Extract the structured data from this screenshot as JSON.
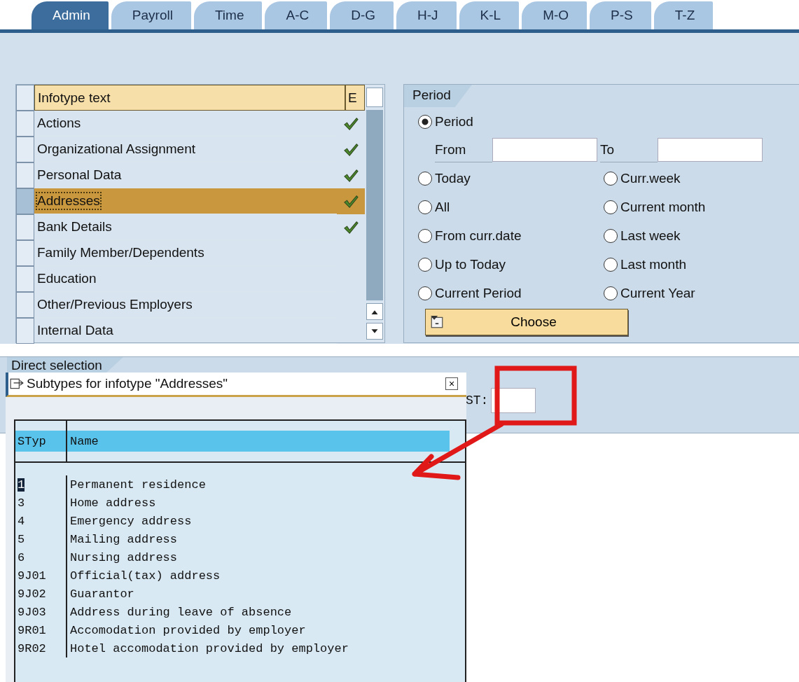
{
  "tabs": [
    {
      "label": "Admin",
      "selected": true
    },
    {
      "label": "Payroll",
      "selected": false
    },
    {
      "label": "Time",
      "selected": false
    },
    {
      "label": "A-C",
      "selected": false
    },
    {
      "label": "D-G",
      "selected": false
    },
    {
      "label": "H-J",
      "selected": false
    },
    {
      "label": "K-L",
      "selected": false
    },
    {
      "label": "M-O",
      "selected": false
    },
    {
      "label": "P-S",
      "selected": false
    },
    {
      "label": "T-Z",
      "selected": false
    }
  ],
  "infotypes": {
    "columns": [
      "Infotype text",
      "E"
    ],
    "rows": [
      {
        "name": "Actions",
        "checked": true,
        "selected": false
      },
      {
        "name": "Organizational Assignment",
        "checked": true,
        "selected": false
      },
      {
        "name": "Personal Data",
        "checked": true,
        "selected": false
      },
      {
        "name": "Addresses",
        "checked": true,
        "selected": true
      },
      {
        "name": "Bank Details",
        "checked": true,
        "selected": false
      },
      {
        "name": "Family Member/Dependents",
        "checked": false,
        "selected": false
      },
      {
        "name": "Education",
        "checked": false,
        "selected": false
      },
      {
        "name": "Other/Previous Employers",
        "checked": false,
        "selected": false
      },
      {
        "name": "Internal Data",
        "checked": false,
        "selected": false
      }
    ]
  },
  "period": {
    "title": "Period",
    "main_option": {
      "label": "Period",
      "selected": true
    },
    "from_label": "From",
    "to_label": "To",
    "options": [
      {
        "label": "Today",
        "selected": false
      },
      {
        "label": "Curr.week",
        "selected": false
      },
      {
        "label": "All",
        "selected": false
      },
      {
        "label": "Current month",
        "selected": false
      },
      {
        "label": "From curr.date",
        "selected": false
      },
      {
        "label": "Last week",
        "selected": false
      },
      {
        "label": "Up to Today",
        "selected": false
      },
      {
        "label": "Last month",
        "selected": false
      },
      {
        "label": "Current Period",
        "selected": false
      },
      {
        "label": "Current Year",
        "selected": false
      }
    ],
    "choose_button": "Choose"
  },
  "direct_selection": {
    "title": "Direct selection",
    "subtype_label": "ST:"
  },
  "popup": {
    "title": "Subtypes for infotype \"Addresses\"",
    "close": "×",
    "columns": [
      "STyp",
      "Name"
    ],
    "rows": [
      {
        "code": "1",
        "name": "Permanent residence",
        "selected": true
      },
      {
        "code": "3",
        "name": "Home address",
        "selected": false
      },
      {
        "code": "4",
        "name": "Emergency address",
        "selected": false
      },
      {
        "code": "5",
        "name": "Mailing address",
        "selected": false
      },
      {
        "code": "6",
        "name": "Nursing address",
        "selected": false
      },
      {
        "code": "9J01",
        "name": "Official(tax) address",
        "selected": false
      },
      {
        "code": "9J02",
        "name": "Guarantor",
        "selected": false
      },
      {
        "code": "9J03",
        "name": "Address during leave of absence",
        "selected": false
      },
      {
        "code": "9R01",
        "name": "Accomodation provided by employer",
        "selected": false
      },
      {
        "code": "9R02",
        "name": "Hotel accomodation provided by employer",
        "selected": false
      }
    ]
  }
}
